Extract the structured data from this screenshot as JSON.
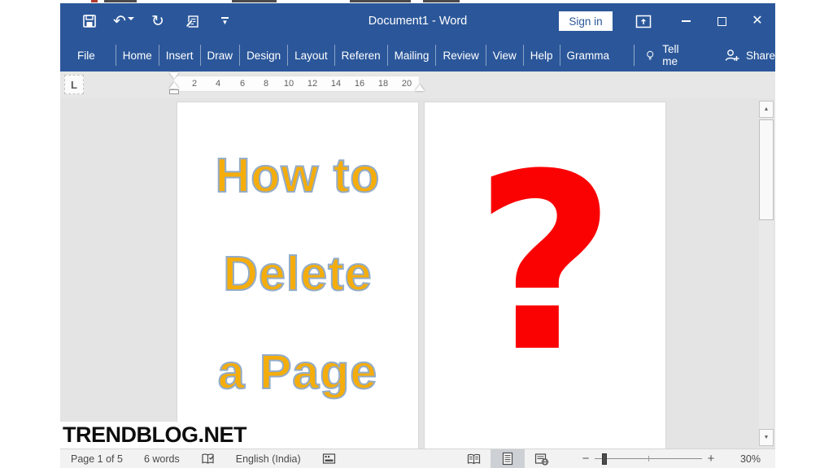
{
  "window": {
    "titlebar": {
      "title": "Document1 - Word",
      "sign_in_label": "Sign in"
    },
    "ribbon": {
      "tabs": [
        "File",
        "Home",
        "Insert",
        "Draw",
        "Design",
        "Layout",
        "Referen",
        "Mailing",
        "Review",
        "View",
        "Help",
        "Gramma"
      ],
      "tell_me_label": "Tell me",
      "share_label": "Share"
    },
    "ruler": {
      "numbers": [
        "2",
        "4",
        "6",
        "8",
        "10",
        "12",
        "14",
        "16",
        "18",
        "20"
      ]
    },
    "document": {
      "page1_lines": [
        "How to",
        "Delete",
        "a Page"
      ],
      "page2_symbol": "?",
      "heading_color": "#F5AD0C",
      "heading_outline_color": "#93ACC8",
      "symbol_color": "#FA0202"
    },
    "watermark": "TRENDBLOG.NET",
    "statusbar": {
      "page_indicator": "Page 1 of 5",
      "word_count": "6 words",
      "language": "English (India)",
      "zoom_level": "30%"
    }
  },
  "icons": {
    "undo": "↶",
    "redo": "↻",
    "minimize": "–",
    "close": "✕",
    "scroll_up": "▲",
    "scroll_down": "▼",
    "ruler_tab_selector": "L",
    "zoom_minus": "−",
    "zoom_plus": "+"
  },
  "colors": {
    "titlebar_blue": "#2B579A",
    "doc_background": "#E4E4E4",
    "statusbar_bg": "#F2F2F2"
  }
}
